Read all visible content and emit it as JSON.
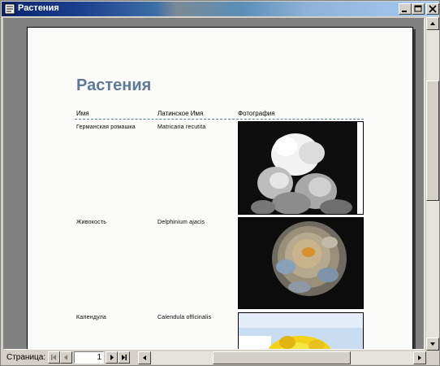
{
  "window": {
    "title": "Растения"
  },
  "report": {
    "title": "Растения",
    "columns": {
      "name": "Имя",
      "latin": "Латинское Имя",
      "photo": "Фотография"
    },
    "rows": [
      {
        "name": "Германская ромашка",
        "latin": "Matricaria recutita"
      },
      {
        "name": "Живокость",
        "latin": "Delphinium ajacis"
      },
      {
        "name": "Календула",
        "latin": "Calendula officinalis"
      }
    ]
  },
  "navigation": {
    "page_label": "Страница:",
    "page_value": "1"
  },
  "icons": {
    "minimize": "minimize-icon",
    "maximize": "maximize-icon",
    "close": "close-icon",
    "first": "first-page-icon",
    "prev": "prev-page-icon",
    "next": "next-page-icon",
    "last": "last-page-icon"
  },
  "colors": {
    "title_accent": "#5f7a96",
    "titlebar": "#0a246a"
  }
}
